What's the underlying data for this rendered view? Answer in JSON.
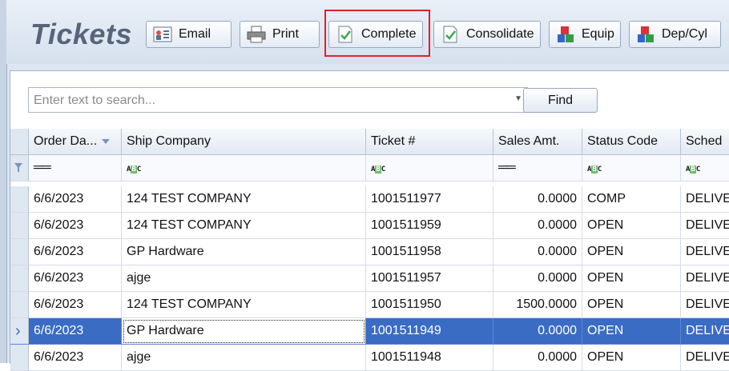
{
  "title": "Tickets",
  "toolbar": {
    "buttons": [
      {
        "label": "Email",
        "icon": "email-contact-icon"
      },
      {
        "label": "Print",
        "icon": "printer-icon"
      },
      {
        "label": "Complete",
        "icon": "checked-document-icon"
      },
      {
        "label": "Consolidate",
        "icon": "checked-document-icon"
      },
      {
        "label": "Equip",
        "icon": "blocks-icon"
      },
      {
        "label": "Dep/Cyl",
        "icon": "blocks-icon"
      }
    ]
  },
  "search": {
    "placeholder": "Enter text to search...",
    "find_label": "Find"
  },
  "grid": {
    "columns": [
      "Order Da...",
      "Ship Company",
      "Ticket #",
      "Sales Amt.",
      "Status Code",
      "Sched"
    ],
    "filter_ops": [
      "=",
      "ABC",
      "ABC",
      "=",
      "ABC",
      "ABC"
    ],
    "rows": [
      {
        "order_date": "6/6/2023",
        "ship_company": "124 TEST COMPANY",
        "ticket": "1001511977",
        "sales_amt": "0.0000",
        "status": "COMP",
        "sched": "DELIVE"
      },
      {
        "order_date": "6/6/2023",
        "ship_company": "124 TEST COMPANY",
        "ticket": "1001511959",
        "sales_amt": "0.0000",
        "status": "OPEN",
        "sched": "DELIVE"
      },
      {
        "order_date": "6/6/2023",
        "ship_company": "GP Hardware",
        "ticket": "1001511958",
        "sales_amt": "0.0000",
        "status": "OPEN",
        "sched": "DELIVE"
      },
      {
        "order_date": "6/6/2023",
        "ship_company": "ajge",
        "ticket": "1001511957",
        "sales_amt": "0.0000",
        "status": "OPEN",
        "sched": "DELIVE"
      },
      {
        "order_date": "6/6/2023",
        "ship_company": "124 TEST COMPANY",
        "ticket": "1001511950",
        "sales_amt": "1500.0000",
        "status": "OPEN",
        "sched": "DELIVE"
      },
      {
        "order_date": "6/6/2023",
        "ship_company": "GP Hardware",
        "ticket": "1001511949",
        "sales_amt": "0.0000",
        "status": "OPEN",
        "sched": "DELIVE",
        "selected": true
      },
      {
        "order_date": "6/6/2023",
        "ship_company": "ajge",
        "ticket": "1001511948",
        "sales_amt": "0.0000",
        "status": "OPEN",
        "sched": "DELIVE"
      }
    ]
  },
  "colors": {
    "selection": "#3a6cc4",
    "highlight_box": "#e0202a",
    "title": "#56657a"
  }
}
